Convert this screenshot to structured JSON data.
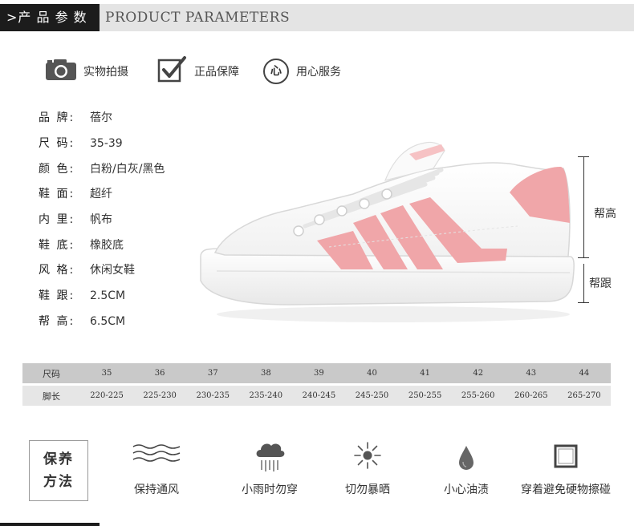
{
  "header": {
    "tag": ">产 品 参 数",
    "title": "PRODUCT PARAMETERS"
  },
  "badges": [
    {
      "icon": "camera-icon",
      "label": "实物拍摄"
    },
    {
      "icon": "checkmark-icon",
      "label": "正品保障"
    },
    {
      "icon": "heart-circle-icon",
      "label": "用心服务",
      "icon_text": "心"
    }
  ],
  "specs": [
    {
      "label": "品 牌:",
      "value": "蓓尔"
    },
    {
      "label": "尺 码:",
      "value": "35-39"
    },
    {
      "label": "颜 色:",
      "value": "白粉/白灰/黑色"
    },
    {
      "label": "鞋 面:",
      "value": "超纤"
    },
    {
      "label": "内 里:",
      "value": "帆布"
    },
    {
      "label": "鞋 底:",
      "value": "橡胶底"
    },
    {
      "label": "风 格:",
      "value": "休闲女鞋"
    },
    {
      "label": "鞋 跟:",
      "value": "2.5CM"
    },
    {
      "label": "帮 高:",
      "value": "6.5CM"
    }
  ],
  "dimensions": {
    "upper_label": "帮高",
    "heel_label": "帮跟"
  },
  "size_table": {
    "size_header": "尺码",
    "foot_header": "脚长",
    "sizes": [
      "35",
      "36",
      "37",
      "38",
      "39",
      "40",
      "41",
      "42",
      "43",
      "44"
    ],
    "foot_lengths": [
      "220-225",
      "225-230",
      "230-235",
      "235-240",
      "240-245",
      "245-250",
      "250-255",
      "255-260",
      "260-265",
      "265-270"
    ]
  },
  "care": {
    "title_line1": "保养",
    "title_line2": "方法",
    "items": [
      {
        "icon": "wind-icon",
        "label": "保持通风"
      },
      {
        "icon": "rain-cloud-icon",
        "label": "小雨时勿穿"
      },
      {
        "icon": "sun-icon",
        "label": "切勿暴晒"
      },
      {
        "icon": "oil-drop-icon",
        "label": "小心油渍"
      },
      {
        "icon": "square-icon",
        "label": "穿着避免硬物擦碰"
      }
    ]
  },
  "colors": {
    "header_dark": "#1c1c1c",
    "header_light": "#e4e4e4",
    "accent_pink": "#f0a6a9",
    "table_head": "#c9c9c9",
    "table_body": "#e6e6e6"
  }
}
